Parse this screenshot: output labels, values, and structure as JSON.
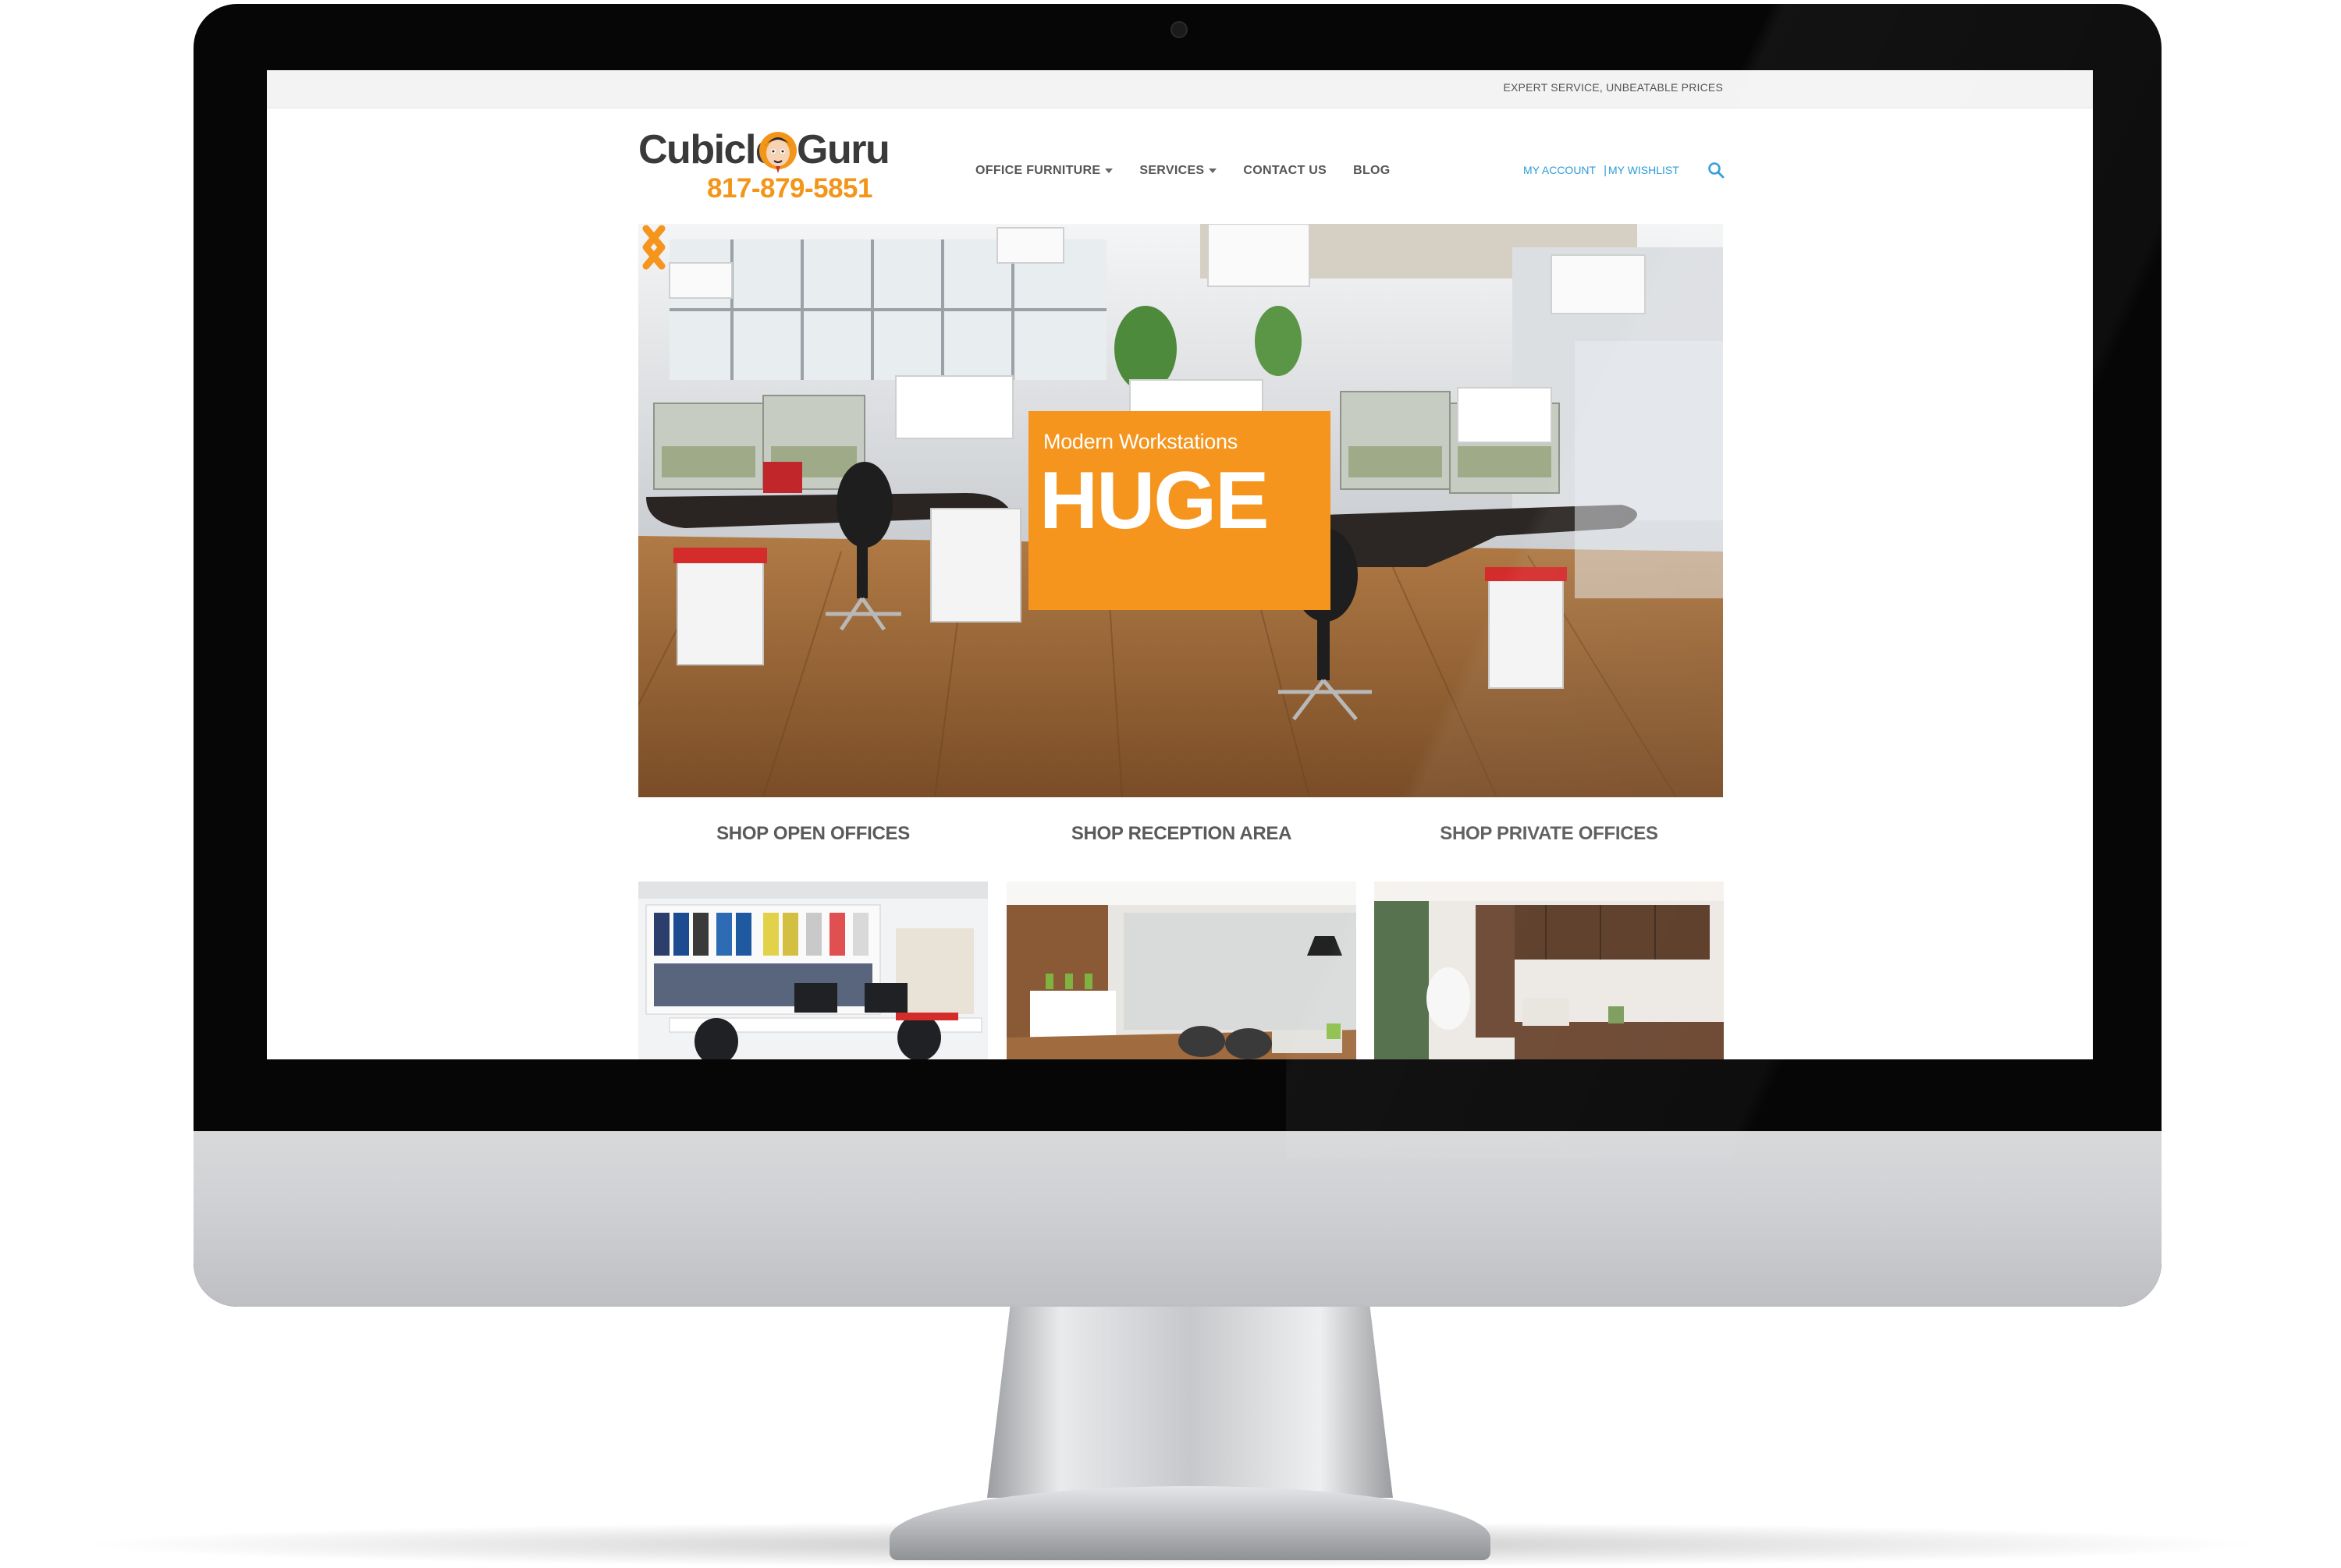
{
  "topbar": {
    "tagline": "EXPERT SERVICE, UNBEATABLE PRICES"
  },
  "logo": {
    "word1": "Cubicle",
    "word2": "Guru",
    "phone": "817-879-5851"
  },
  "nav": {
    "items": [
      {
        "label": "OFFICE FURNITURE",
        "dropdown": true
      },
      {
        "label": "SERVICES",
        "dropdown": true
      },
      {
        "label": "CONTACT US",
        "dropdown": false
      },
      {
        "label": "BLOG",
        "dropdown": false
      }
    ]
  },
  "account": {
    "my_account": "MY ACCOUNT",
    "separator": "|",
    "my_wishlist": "MY WISHLIST",
    "search_icon": "search-icon"
  },
  "hero": {
    "promo_subtitle": "Modern Workstations",
    "promo_title": "HUGE",
    "prev_icon": "chevron-left-icon",
    "next_icon": "chevron-right-icon"
  },
  "categories": [
    {
      "label": "SHOP OPEN OFFICES"
    },
    {
      "label": "SHOP RECEPTION AREA"
    },
    {
      "label": "SHOP PRIVATE OFFICES"
    }
  ],
  "colors": {
    "accent": "#f5951e",
    "link": "#2d9bd7",
    "nav_text": "#555555"
  }
}
